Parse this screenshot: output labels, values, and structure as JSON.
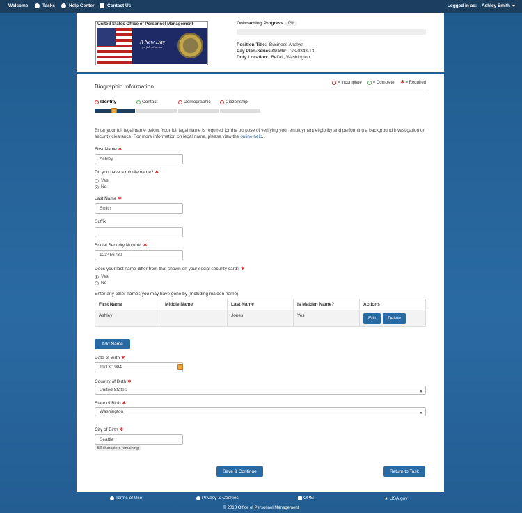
{
  "topnav": {
    "welcome": "Welcome",
    "tasks": "Tasks",
    "help": "Help Center",
    "contact": "Contact Us",
    "logged_in_label": "Logged in as:",
    "user_name": "Ashley Smith"
  },
  "header": {
    "logo_text": "United States Office of Personnel Management",
    "logo_tagline": "A New Day",
    "logo_subtag": "for federal service",
    "progress_label": "Onboarding Progress",
    "progress_pct": "0%",
    "position_title_label": "Position Title:",
    "position_title": "Business Analyst",
    "pay_plan_label": "Pay Plan-Series-Grade:",
    "pay_plan": "GS-0343-13",
    "duty_location_label": "Duty Location:",
    "duty_location": "Belfair, Washington"
  },
  "section": {
    "title": "Biographic Information",
    "legend_incomplete": "= Incomplete",
    "legend_complete": "= Complete",
    "legend_required": "= Required"
  },
  "steps": [
    "Identity",
    "Contact",
    "Demographic",
    "Citizenship"
  ],
  "intro": {
    "text": "Enter your full legal name below. Your full legal name is required for the purpose of verifying your employment eligibility and performing a background investigation or security clearance. For more information on legal name, please view the ",
    "link": "online help",
    "end": "."
  },
  "form": {
    "first_name_label": "First Name",
    "first_name": "Ashley",
    "middle_q": "Do you have a middle name?",
    "yes": "Yes",
    "no": "No",
    "last_name_label": "Last Name",
    "last_name": "Smith",
    "suffix_label": "Suffix",
    "suffix": "",
    "ssn_label": "Social Security Number",
    "ssn": "123456789",
    "diff_q": "Does your last name differ from that shown on your social security card?",
    "other_names_label": "Enter any other names you may have gone by (Including maiden name).",
    "add_name": "Add Name",
    "dob_label": "Date of Birth",
    "dob": "11/13/1984",
    "country_label": "Country of Birth",
    "country": "United States",
    "state_label": "State of Birth",
    "state": "Washington",
    "city_label": "City of Birth",
    "city": "Seattle",
    "chars_remaining": "53 characters remaining"
  },
  "table": {
    "headers": [
      "First Name",
      "Middle Name",
      "Last Name",
      "Is Maiden Name?",
      "Actions"
    ],
    "rows": [
      {
        "first": "Ashley",
        "middle": "",
        "last": "Jones",
        "maiden": "Yes"
      }
    ],
    "edit": "Edit",
    "delete": "Delete"
  },
  "actions": {
    "save": "Save & Continue",
    "return": "Return to Task"
  },
  "footer": {
    "terms": "Terms of Use",
    "privacy": "Privacy & Cookies",
    "opm": "OPM",
    "usa": "USA.gov",
    "copyright": "© 2013 Office of Personnel Management"
  },
  "colors": {
    "nav_bg": "#1d3f5f",
    "accent": "#2a6aa3",
    "page_bg": "#235d92",
    "required": "#cc3333",
    "complete": "#55aa55",
    "step_knob": "#f0a53c"
  }
}
